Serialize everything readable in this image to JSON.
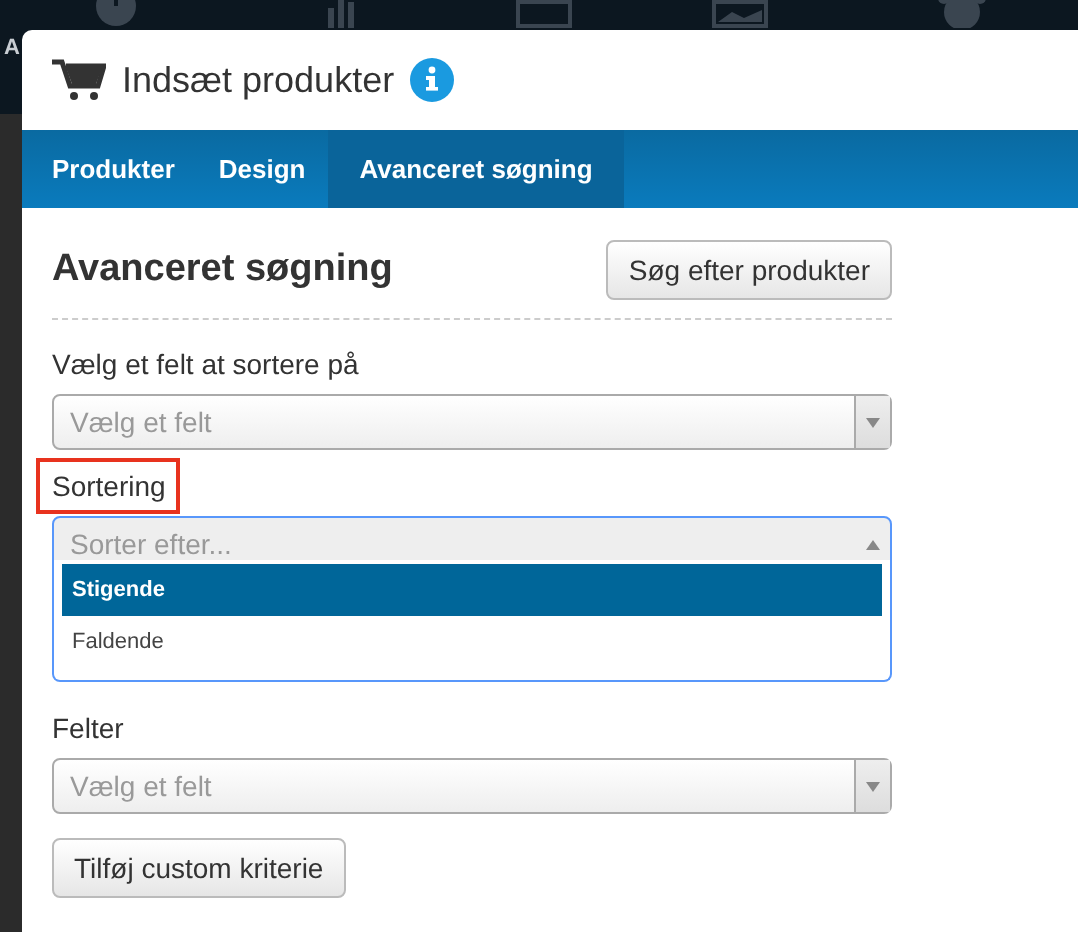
{
  "background": {
    "sidebar_text": "A"
  },
  "dialog": {
    "title": "Indsæt produkter"
  },
  "tabs": [
    {
      "label": "Produkter",
      "selected": false
    },
    {
      "label": "Design",
      "selected": false
    },
    {
      "label": "Avanceret søgning",
      "selected": true
    }
  ],
  "section": {
    "title": "Avanceret søgning",
    "search_button": "Søg efter produkter"
  },
  "fields": [
    {
      "label": "Vælg et felt at sortere på",
      "placeholder": "Vælg et felt",
      "highlighted": false,
      "expanded": false
    },
    {
      "label": "Sortering",
      "placeholder": "Sorter efter...",
      "highlighted": true,
      "expanded": true,
      "options": [
        {
          "label": "Stigende",
          "selected": true
        },
        {
          "label": "Faldende",
          "selected": false
        }
      ]
    },
    {
      "label": "Felter",
      "placeholder": "Vælg et felt",
      "highlighted": false,
      "expanded": false
    }
  ],
  "add_button": "Tilføj custom kriterie"
}
